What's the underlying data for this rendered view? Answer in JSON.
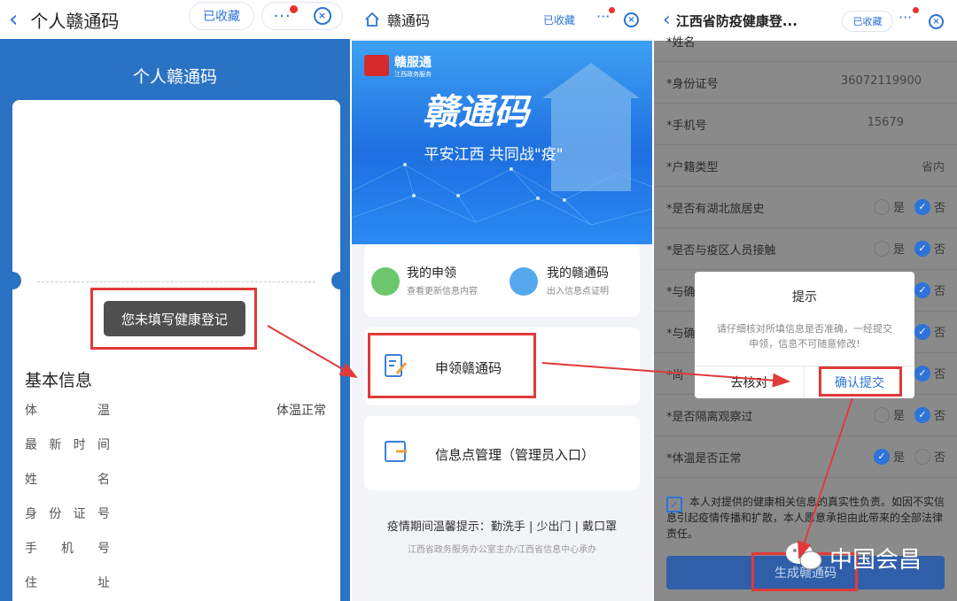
{
  "panel1": {
    "back_icon": "chevron-left-icon",
    "title": "个人赣通码",
    "fav_label": "已收藏",
    "card_title": "个人赣通码",
    "toast": "您未填写健康登记",
    "section_title": "基本信息",
    "fields": [
      {
        "label": "体温",
        "value": "体温正常"
      },
      {
        "label": "最新时间",
        "value": ""
      },
      {
        "label": "姓名",
        "value": ""
      },
      {
        "label": "身份证号",
        "value": ""
      },
      {
        "label": "手机号",
        "value": ""
      },
      {
        "label": "住址",
        "value": ""
      }
    ]
  },
  "panel2": {
    "title": "赣通码",
    "fav_label": "已收藏",
    "logo_text": "赣服通",
    "logo_sub": "江西政务服务",
    "banner_title": "赣通码",
    "banner_slogan": "平安江西 共同战\"疫\"",
    "menu": [
      {
        "title": "我的申领",
        "sub": "查看更新信息内容"
      },
      {
        "title": "我的赣通码",
        "sub": "出入信息点证明"
      }
    ],
    "apply_label": "申领赣通码",
    "manage_label": "信息点管理（管理员入口）",
    "tip": "疫情期间温馨提示：勤洗手 | 少出门 | 戴口罩",
    "footer": "江西省政务服务办公室主办/江西省信息中心承办"
  },
  "panel3": {
    "title": "江西省防疫健康登...",
    "fav_label": "已收藏",
    "rows": [
      {
        "label": "*姓名",
        "value": "",
        "type": "text"
      },
      {
        "label": "*身份证号",
        "value": "36072119900",
        "type": "text"
      },
      {
        "label": "*手机号",
        "value": "15679",
        "type": "text"
      },
      {
        "label": "*户籍类型",
        "value": "省内",
        "type": "text"
      },
      {
        "label": "*是否有湖北旅居史",
        "yes": "是",
        "no": "否",
        "type": "radio",
        "selected": "no"
      },
      {
        "label": "*是否与疫区人员接触",
        "yes": "是",
        "no": "否",
        "type": "radio",
        "selected": "no"
      },
      {
        "label": "*与确",
        "yes": "是",
        "no": "否",
        "type": "radio",
        "selected": "no"
      },
      {
        "label": "*与确",
        "yes": "是",
        "no": "否",
        "type": "radio",
        "selected": "no"
      },
      {
        "label": "*尚",
        "yes": "是",
        "no": "否",
        "type": "radio",
        "selected": "no"
      },
      {
        "label": "*是否隔离观察过",
        "yes": "是",
        "no": "否",
        "type": "radio",
        "selected": "no"
      },
      {
        "label": "*体温是否正常",
        "yes": "是",
        "no": "否",
        "type": "radio",
        "selected": "yes"
      }
    ],
    "agree_text": "本人对提供的健康相关信息的真实性负责。如因不实信息引起疫情传播和扩散，本人愿意承担由此带来的全部法律责任。",
    "submit_label": "生成赣通码",
    "dialog": {
      "title": "提示",
      "message": "请仔细核对所填信息是否准确，一经提交申领，信息不可随意修改!",
      "cancel": "去核对",
      "confirm": "确认提交"
    },
    "watermark": "中国会昌"
  },
  "colors": {
    "accent": "#2d73d8",
    "annotation": "#e03a3a",
    "card_blue": "#2a72c4"
  }
}
